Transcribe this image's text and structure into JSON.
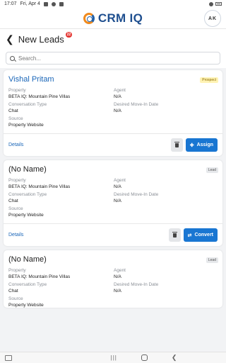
{
  "status_bar": {
    "time": "17:07",
    "date": "Fri, Apr 4"
  },
  "header": {
    "app_name": "CRM IQ",
    "avatar_initials": "AK"
  },
  "page": {
    "title": "New Leads",
    "count": "22",
    "back_icon": "chevron-left-icon"
  },
  "search": {
    "placeholder": "Search..."
  },
  "field_labels": {
    "property": "Property",
    "agent": "Agent",
    "conversation_type": "Conversation Type",
    "move_in": "Desired Move-In Date",
    "source": "Source"
  },
  "cards": [
    {
      "name": "Vishal Pritam",
      "status": "Prospect",
      "property": "BETA IQ: Mountain Pine Villas",
      "agent": "N/A",
      "conversation_type": "Chat",
      "move_in": "N/A",
      "source": "Property Website",
      "details_label": "Details",
      "action_label": "Assign",
      "action_icon": "assign-user-icon"
    },
    {
      "name": "(No Name)",
      "status": "Lead",
      "property": "BETA IQ: Mountain Pine Villas",
      "agent": "N/A",
      "conversation_type": "Chat",
      "move_in": "N/A",
      "source": "Property Website",
      "details_label": "Details",
      "action_label": "Convert",
      "action_icon": "convert-icon"
    },
    {
      "name": "(No Name)",
      "status": "Lead",
      "property": "BETA IQ: Mountain Pine Villas",
      "agent": "N/A",
      "conversation_type": "Chat",
      "move_in": "N/A",
      "source": "Property Website"
    }
  ],
  "colors": {
    "accent": "#1976d2",
    "brand_blue": "#1f4f8f",
    "brand_orange": "#f08a1d",
    "prospect_badge": "#fff3b5",
    "lead_badge": "#e6e8eb",
    "count_badge": "#e53935"
  }
}
